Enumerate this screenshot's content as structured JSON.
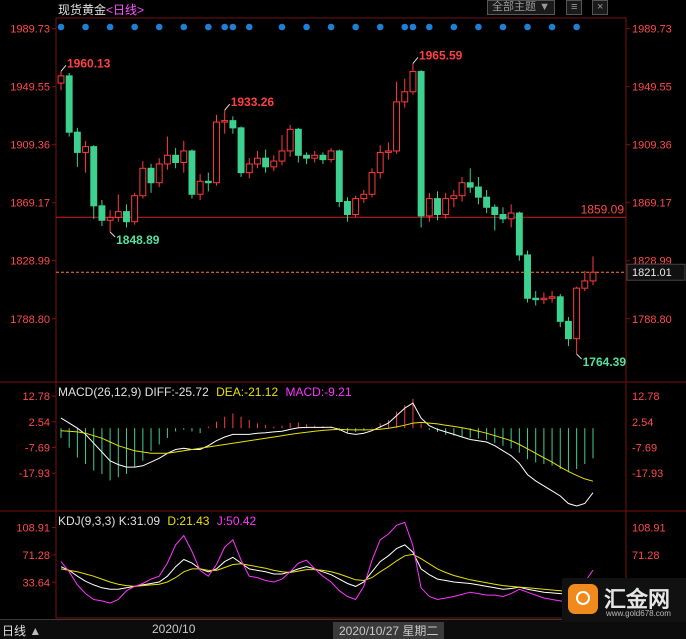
{
  "header": {
    "instrument": "现货黄金",
    "period": "<日线>",
    "theme_button": "全部主题"
  },
  "macd": {
    "label": "MACD(26,12,9)",
    "diff": "-25.72",
    "dea": "-21.12",
    "macd": "-9.21"
  },
  "kdj": {
    "label": "KDJ(9,3,3)",
    "k": "31.09",
    "d": "21.43",
    "j": "50.42"
  },
  "footer": {
    "period_button": "日线",
    "month_tick": "2020/10",
    "cursor_date": "2020/10/27 星期二"
  },
  "brand": {
    "name": "汇金网",
    "url": "www.gold678.com"
  },
  "colors": {
    "up": "#ff3b3b",
    "down": "#3dd18f",
    "grid": "#7a1010",
    "axis_text": "#ff4a4a",
    "diff_line": "#ffffff",
    "dea_line": "#e8e000",
    "j_line": "#ff33ff",
    "event_dot": "#1e7fd6"
  },
  "chart_data": [
    {
      "type": "candlestick",
      "title": "现货黄金",
      "ylim": [
        1764.39,
        1995
      ],
      "yticks": [
        1989.73,
        1949.55,
        1909.36,
        1869.17,
        1828.99,
        1788.8
      ],
      "current_price": "1821.01",
      "horizontal_line": {
        "value": 1859.09,
        "label": "1859.09"
      },
      "annotations": [
        {
          "label": "1960.13",
          "type": "high"
        },
        {
          "label": "1848.89",
          "type": "low"
        },
        {
          "label": "1933.26",
          "type": "high"
        },
        {
          "label": "1965.59",
          "type": "high"
        },
        {
          "label": "1764.39",
          "type": "low"
        }
      ],
      "event_markers": 24,
      "candles": [
        [
          1952,
          1957,
          1960.13,
          1947
        ],
        [
          1957,
          1918,
          1959,
          1915
        ],
        [
          1918,
          1904,
          1921,
          1894
        ],
        [
          1904,
          1908,
          1912,
          1890
        ],
        [
          1908,
          1867,
          1909,
          1858
        ],
        [
          1867,
          1857,
          1871,
          1853
        ],
        [
          1857,
          1859,
          1864,
          1848.89
        ],
        [
          1859,
          1863,
          1875,
          1856
        ],
        [
          1863,
          1856,
          1868,
          1852
        ],
        [
          1856,
          1874,
          1876,
          1854
        ],
        [
          1874,
          1893,
          1898,
          1872
        ],
        [
          1893,
          1883,
          1896,
          1876
        ],
        [
          1883,
          1896,
          1900,
          1880
        ],
        [
          1896,
          1902,
          1915,
          1892
        ],
        [
          1902,
          1897,
          1907,
          1893
        ],
        [
          1897,
          1905,
          1912,
          1890
        ],
        [
          1905,
          1875,
          1906,
          1872
        ],
        [
          1875,
          1884,
          1889,
          1871
        ],
        [
          1884,
          1883,
          1890,
          1877
        ],
        [
          1883,
          1925,
          1930,
          1881
        ],
        [
          1925,
          1926,
          1933.26,
          1917
        ],
        [
          1926,
          1921,
          1929,
          1917
        ],
        [
          1921,
          1890,
          1922,
          1887
        ],
        [
          1890,
          1896,
          1900,
          1886
        ],
        [
          1896,
          1900,
          1905,
          1893
        ],
        [
          1900,
          1894,
          1906,
          1890
        ],
        [
          1894,
          1898,
          1902,
          1891
        ],
        [
          1898,
          1905,
          1916,
          1895
        ],
        [
          1905,
          1920,
          1923,
          1901
        ],
        [
          1920,
          1902,
          1921,
          1897
        ],
        [
          1902,
          1900,
          1904,
          1896
        ],
        [
          1900,
          1902,
          1905,
          1897
        ],
        [
          1902,
          1899,
          1904,
          1896
        ],
        [
          1899,
          1905,
          1907,
          1897
        ],
        [
          1905,
          1870,
          1906,
          1866
        ],
        [
          1870,
          1861,
          1873,
          1856
        ],
        [
          1861,
          1872,
          1874,
          1859
        ],
        [
          1872,
          1875,
          1878,
          1869
        ],
        [
          1875,
          1890,
          1893,
          1873
        ],
        [
          1890,
          1904,
          1909,
          1886
        ],
        [
          1904,
          1905,
          1911,
          1899
        ],
        [
          1905,
          1939,
          1953,
          1903
        ],
        [
          1939,
          1946,
          1955,
          1935
        ],
        [
          1946,
          1960,
          1965.59,
          1944
        ],
        [
          1960,
          1860,
          1961,
          1852
        ],
        [
          1860,
          1872,
          1876,
          1856
        ],
        [
          1872,
          1861,
          1877,
          1857
        ],
        [
          1861,
          1872,
          1876,
          1858
        ],
        [
          1872,
          1874,
          1878,
          1866
        ],
        [
          1874,
          1883,
          1887,
          1870
        ],
        [
          1883,
          1880,
          1893,
          1876
        ],
        [
          1880,
          1873,
          1887,
          1868
        ],
        [
          1873,
          1866,
          1878,
          1862
        ],
        [
          1866,
          1861,
          1868,
          1850
        ],
        [
          1861,
          1858,
          1866,
          1855
        ],
        [
          1858,
          1862,
          1868,
          1852
        ],
        [
          1862,
          1833,
          1863,
          1829
        ],
        [
          1833,
          1803,
          1836,
          1800
        ],
        [
          1803,
          1802,
          1808,
          1798
        ],
        [
          1802,
          1803,
          1807,
          1799
        ],
        [
          1803,
          1804,
          1808,
          1800
        ],
        [
          1804,
          1787,
          1806,
          1783
        ],
        [
          1787,
          1775,
          1790,
          1770
        ],
        [
          1775,
          1810,
          1811,
          1764.39
        ],
        [
          1810,
          1815,
          1822,
          1808
        ],
        [
          1815,
          1821.01,
          1832,
          1812
        ]
      ]
    },
    {
      "type": "bar",
      "title": "MACD(26,12,9)",
      "yticks": [
        12.78,
        2.54,
        -7.69,
        -17.93
      ],
      "macd_bars": [
        -3,
        -6,
        -9,
        -11,
        -13,
        -14,
        -16,
        -15,
        -14,
        -12,
        -10,
        -7,
        -5,
        -3,
        -1,
        -0.5,
        -1,
        -1.5,
        0.5,
        2,
        3.5,
        4.5,
        3.5,
        2.5,
        1.5,
        1,
        0.5,
        0.8,
        1.6,
        1.8,
        1.2,
        0.8,
        0.6,
        0.6,
        -0.8,
        -1.6,
        -1.2,
        -0.8,
        0.2,
        1.5,
        2.5,
        5,
        7,
        9,
        1.5,
        -0.5,
        -1.2,
        -2,
        -2.3,
        -2.6,
        -3,
        -3.2,
        -3.6,
        -4.6,
        -5.4,
        -6.2,
        -7.5,
        -9.5,
        -10.5,
        -11,
        -11.5,
        -12.5,
        -13.5,
        -12.5,
        -11,
        -9.21
      ],
      "diff": [
        4,
        2,
        0,
        -2.5,
        -6,
        -9.5,
        -13,
        -14.5,
        -15.5,
        -15.5,
        -15,
        -13.5,
        -12,
        -10,
        -8.5,
        -8,
        -8.5,
        -8.5,
        -7,
        -5,
        -3.5,
        -2.5,
        -2.5,
        -2.5,
        -2,
        -1.8,
        -1.5,
        -1.2,
        -0.5,
        0.2,
        0.3,
        0.3,
        0.3,
        0.4,
        -0.5,
        -2,
        -2.5,
        -2,
        -1,
        0.5,
        2,
        5,
        8,
        10,
        4,
        1,
        -0.5,
        -1.5,
        -2.5,
        -3.5,
        -4.5,
        -5,
        -5.5,
        -7,
        -9,
        -11,
        -14,
        -18.5,
        -21,
        -23,
        -25,
        -27,
        -30,
        -31,
        -30,
        -25.72
      ],
      "dea": [
        -1,
        -1.2,
        -1.5,
        -2,
        -3,
        -4,
        -5.5,
        -7,
        -8,
        -9,
        -9.5,
        -10,
        -10,
        -10,
        -9.5,
        -9,
        -8.5,
        -8,
        -7.5,
        -7,
        -6.5,
        -6,
        -5.5,
        -5,
        -4.5,
        -4,
        -3.5,
        -3,
        -2.5,
        -2,
        -1.6,
        -1.2,
        -0.9,
        -0.6,
        -0.5,
        -0.6,
        -0.7,
        -0.7,
        -0.6,
        -0.4,
        0,
        0.5,
        1.2,
        2,
        2.3,
        2,
        1.7,
        1.2,
        0.7,
        0.2,
        -0.5,
        -1.2,
        -2,
        -3,
        -4,
        -5,
        -6.5,
        -8.2,
        -10,
        -11.8,
        -13.5,
        -15.5,
        -17.2,
        -18.8,
        -20.2,
        -21.12
      ]
    },
    {
      "type": "line",
      "title": "KDJ(9,3,3)",
      "yticks": [
        108.91,
        71.28,
        33.64
      ],
      "k": [
        55,
        50,
        42,
        35,
        30,
        26,
        24,
        24,
        26,
        28,
        30,
        32,
        34,
        42,
        55,
        65,
        60,
        52,
        48,
        52,
        62,
        68,
        60,
        52,
        50,
        48,
        45,
        45,
        48,
        52,
        55,
        52,
        48,
        44,
        38,
        32,
        28,
        34,
        48,
        62,
        70,
        80,
        85,
        75,
        52,
        44,
        38,
        36,
        34,
        33,
        32,
        30,
        28,
        26,
        24,
        25,
        27,
        24,
        22,
        20,
        19,
        18,
        17,
        18,
        24,
        31.09
      ],
      "d": [
        52,
        50,
        48,
        45,
        42,
        38,
        34,
        31,
        29,
        28,
        29,
        30,
        31,
        34,
        40,
        48,
        52,
        52,
        50,
        50,
        54,
        58,
        59,
        57,
        55,
        53,
        50,
        48,
        47,
        49,
        51,
        51,
        50,
        48,
        45,
        41,
        37,
        36,
        40,
        48,
        55,
        63,
        70,
        72,
        66,
        59,
        52,
        47,
        43,
        40,
        37,
        35,
        33,
        31,
        29,
        28,
        27,
        26,
        25,
        24,
        23,
        22,
        21,
        20,
        20,
        21.43
      ],
      "j": [
        62,
        48,
        30,
        18,
        10,
        8,
        5,
        10,
        22,
        28,
        32,
        38,
        42,
        60,
        85,
        98,
        76,
        50,
        42,
        58,
        82,
        92,
        64,
        42,
        40,
        36,
        34,
        38,
        48,
        60,
        64,
        52,
        42,
        34,
        22,
        14,
        10,
        28,
        64,
        92,
        100,
        112,
        116,
        84,
        26,
        14,
        10,
        12,
        14,
        17,
        20,
        18,
        16,
        16,
        14,
        18,
        24,
        20,
        16,
        12,
        10,
        8,
        6,
        12,
        34,
        50.42
      ]
    }
  ]
}
